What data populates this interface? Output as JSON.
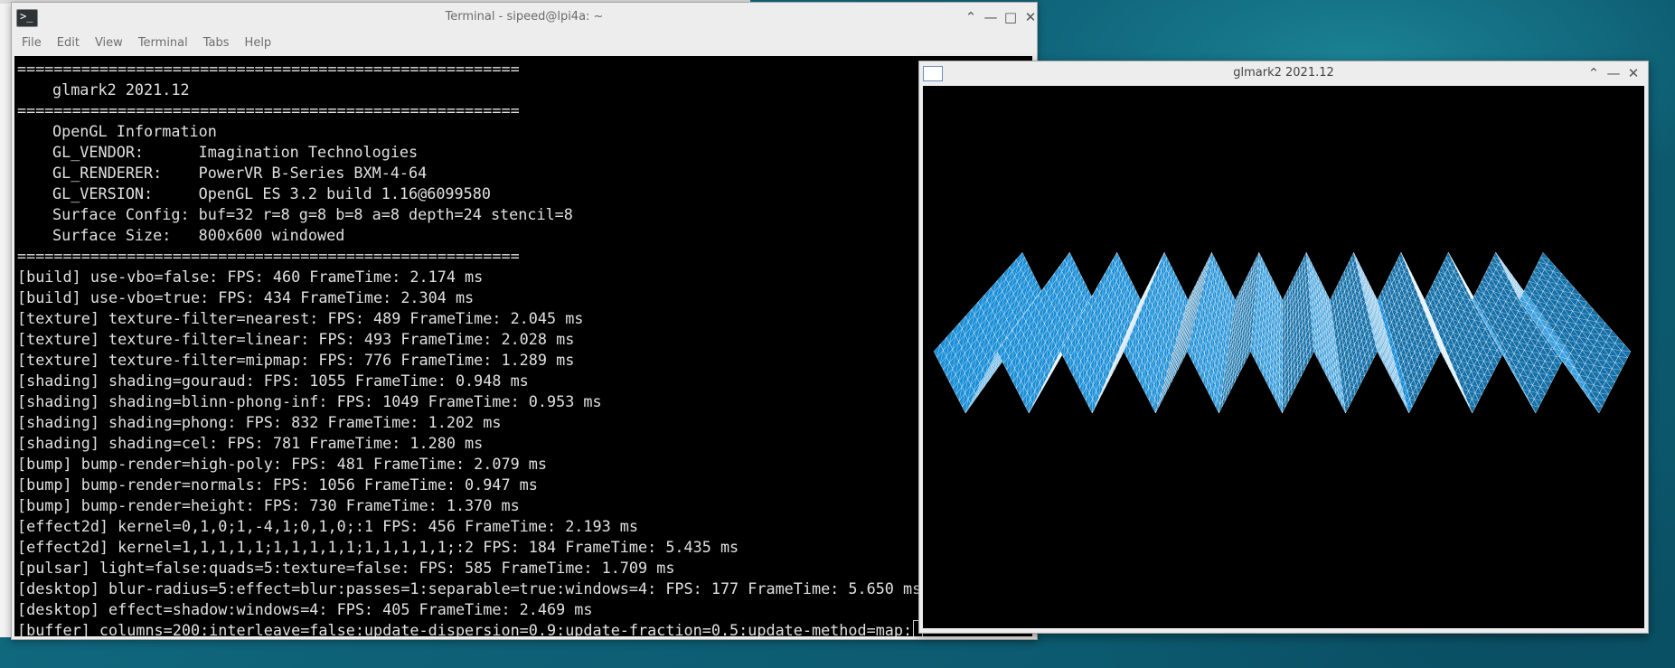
{
  "terminal": {
    "title": "Terminal - sipeed@lpi4a: ~",
    "menu": [
      "File",
      "Edit",
      "View",
      "Terminal",
      "Tabs",
      "Help"
    ],
    "lines": [
      {
        "text": "=======================================================",
        "indent": false
      },
      {
        "text": "glmark2 2021.12",
        "indent": true
      },
      {
        "text": "=======================================================",
        "indent": false
      },
      {
        "text": "OpenGL Information",
        "indent": true
      },
      {
        "text": "GL_VENDOR:      Imagination Technologies",
        "indent": true
      },
      {
        "text": "GL_RENDERER:    PowerVR B-Series BXM-4-64",
        "indent": true
      },
      {
        "text": "GL_VERSION:     OpenGL ES 3.2 build 1.16@6099580",
        "indent": true
      },
      {
        "text": "Surface Config: buf=32 r=8 g=8 b=8 a=8 depth=24 stencil=8",
        "indent": true
      },
      {
        "text": "Surface Size:   800x600 windowed",
        "indent": true
      },
      {
        "text": "=======================================================",
        "indent": false
      },
      {
        "text": "[build] use-vbo=false: FPS: 460 FrameTime: 2.174 ms",
        "indent": false
      },
      {
        "text": "[build] use-vbo=true: FPS: 434 FrameTime: 2.304 ms",
        "indent": false
      },
      {
        "text": "[texture] texture-filter=nearest: FPS: 489 FrameTime: 2.045 ms",
        "indent": false
      },
      {
        "text": "[texture] texture-filter=linear: FPS: 493 FrameTime: 2.028 ms",
        "indent": false
      },
      {
        "text": "[texture] texture-filter=mipmap: FPS: 776 FrameTime: 1.289 ms",
        "indent": false
      },
      {
        "text": "[shading] shading=gouraud: FPS: 1055 FrameTime: 0.948 ms",
        "indent": false
      },
      {
        "text": "[shading] shading=blinn-phong-inf: FPS: 1049 FrameTime: 0.953 ms",
        "indent": false
      },
      {
        "text": "[shading] shading=phong: FPS: 832 FrameTime: 1.202 ms",
        "indent": false
      },
      {
        "text": "[shading] shading=cel: FPS: 781 FrameTime: 1.280 ms",
        "indent": false
      },
      {
        "text": "[bump] bump-render=high-poly: FPS: 481 FrameTime: 2.079 ms",
        "indent": false
      },
      {
        "text": "[bump] bump-render=normals: FPS: 1056 FrameTime: 0.947 ms",
        "indent": false
      },
      {
        "text": "[bump] bump-render=height: FPS: 730 FrameTime: 1.370 ms",
        "indent": false
      },
      {
        "text": "[effect2d] kernel=0,1,0;1,-4,1;0,1,0;:1 FPS: 456 FrameTime: 2.193 ms",
        "indent": false
      },
      {
        "text": "[effect2d] kernel=1,1,1,1,1;1,1,1,1,1;1,1,1,1,1;:2 FPS: 184 FrameTime: 5.435 ms",
        "indent": false
      },
      {
        "text": "[pulsar] light=false:quads=5:texture=false: FPS: 585 FrameTime: 1.709 ms",
        "indent": false
      },
      {
        "text": "[desktop] blur-radius=5:effect=blur:passes=1:separable=true:windows=4: FPS: 177 FrameTime: 5.650 ms",
        "indent": false
      },
      {
        "text": "[desktop] effect=shadow:windows=4: FPS: 405 FrameTime: 2.469 ms",
        "indent": false
      },
      {
        "text": "[buffer] columns=200:interleave=false:update-dispersion=0.9:update-fraction=0.5:update-method=map:",
        "indent": false,
        "cursor": true
      }
    ]
  },
  "glmark_window": {
    "title": "glmark2 2021.12",
    "mesh_color": "#1a8fd8",
    "mesh_line_color": "#ffffff",
    "canvas_bg": "#000000"
  },
  "window_buttons": {
    "maximize_up": "⌃",
    "minimize": "—",
    "restore": "□",
    "close": "✕"
  }
}
